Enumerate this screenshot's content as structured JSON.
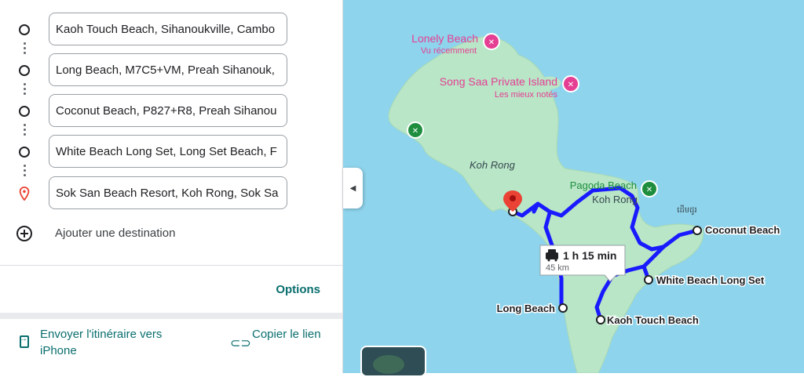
{
  "waypoints": [
    {
      "value": "Kaoh Touch Beach, Sihanoukville, Cambo",
      "type": "circle"
    },
    {
      "value": "Long Beach, M7C5+VM, Preah Sihanouk,",
      "type": "circle"
    },
    {
      "value": "Coconut Beach, P827+R8, Preah Sihanou",
      "type": "circle"
    },
    {
      "value": "White Beach Long Set, Long Set Beach, F",
      "type": "circle"
    },
    {
      "value": "Sok San Beach Resort, Koh Rong, Sok Sa",
      "type": "pin"
    }
  ],
  "add_destination": "Ajouter une destination",
  "options_label": "Options",
  "send_label": "Envoyer l'itinéraire vers iPhone",
  "copy_label": "Copier le lien",
  "map": {
    "island_label": "Koh Rong",
    "poi": [
      {
        "name": "Lonely Beach",
        "sub": "Vu récemment"
      },
      {
        "name": "Song Saa Private Island",
        "sub": "Les mieux notés"
      },
      {
        "name": "Pagoda Beach",
        "sub": ""
      }
    ],
    "koh_rong_label2": "Koh Rong",
    "khmer_label": "ដើមដូរ",
    "stops": [
      "Coconut Beach",
      "White Beach Long Set",
      "Long Beach",
      "Kaoh Touch Beach"
    ],
    "route_time": "1 h 15 min",
    "route_distance": "45 km"
  },
  "colors": {
    "accent": "#0b6e6e",
    "route": "#1a1aff",
    "water": "#8ed4ec",
    "land": "#b8e6c7",
    "poi_pink": "#e53f93",
    "poi_green": "#1e8e3e",
    "pin_red": "#ea4335"
  },
  "icons": [
    "circle-waypoint-icon",
    "pin-icon",
    "plus-icon",
    "send-to-phone-icon",
    "link-icon",
    "car-icon",
    "collapse-arrow-icon"
  ]
}
